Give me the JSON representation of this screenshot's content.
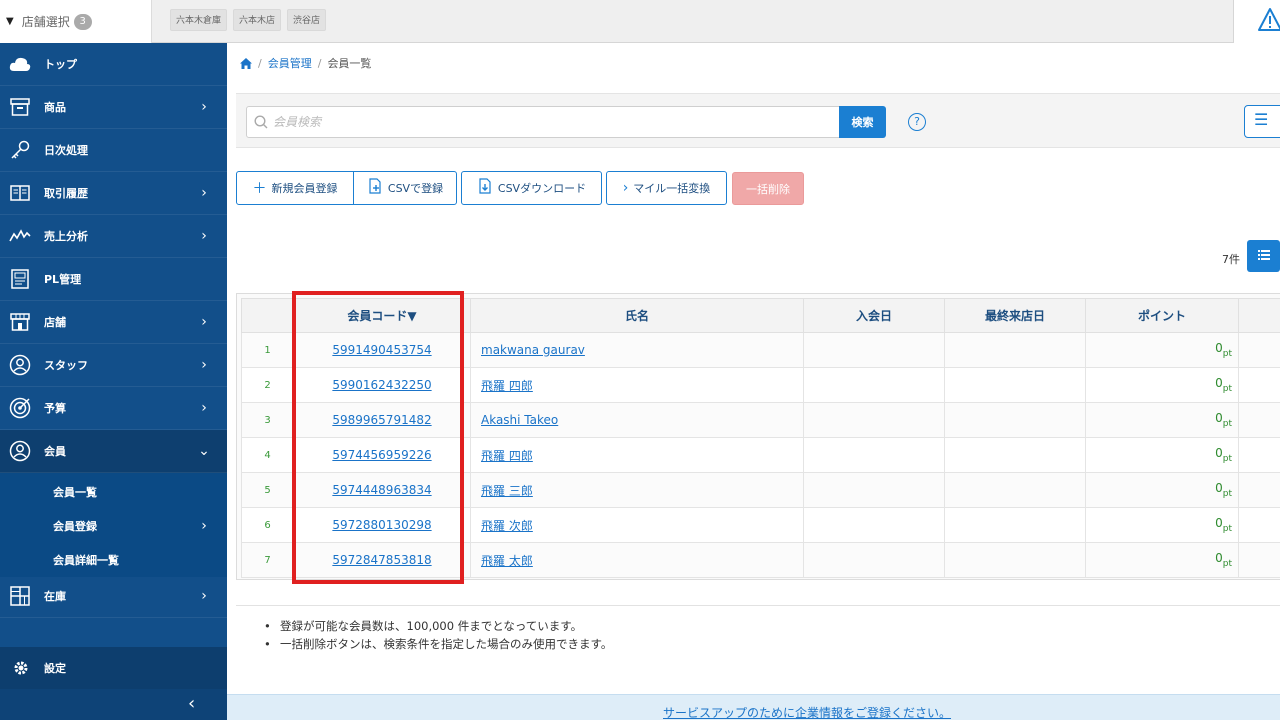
{
  "topbar": {
    "store_select_label": "店舗選択",
    "store_count": "3",
    "stores": [
      "六本木倉庫",
      "六本木店",
      "渋谷店"
    ]
  },
  "sidebar": {
    "items": [
      {
        "label": "トップ",
        "icon": "cloud-icon",
        "chevron": false
      },
      {
        "label": "商品",
        "icon": "box-icon",
        "chevron": true
      },
      {
        "label": "日次処理",
        "icon": "key-icon",
        "chevron": false
      },
      {
        "label": "取引履歴",
        "icon": "book-icon",
        "chevron": true
      },
      {
        "label": "売上分析",
        "icon": "line-chart-icon",
        "chevron": true
      },
      {
        "label": "PL管理",
        "icon": "report-icon",
        "chevron": false
      },
      {
        "label": "店舗",
        "icon": "store-icon",
        "chevron": true
      },
      {
        "label": "スタッフ",
        "icon": "person-icon",
        "chevron": true
      },
      {
        "label": "予算",
        "icon": "target-icon",
        "chevron": true
      },
      {
        "label": "会員",
        "icon": "member-icon",
        "chevron": true
      }
    ],
    "sub_items": [
      {
        "label": "会員一覧",
        "chevron": false
      },
      {
        "label": "会員登録",
        "chevron": true
      },
      {
        "label": "会員詳細一覧",
        "chevron": false
      }
    ],
    "inventory": {
      "label": "在庫",
      "icon": "grid-icon"
    },
    "settings_label": "設定",
    "collapse_glyph": "‹"
  },
  "breadcrumb": {
    "level1": "会員管理",
    "level2": "会員一覧"
  },
  "search": {
    "placeholder": "会員検索",
    "button": "検索",
    "help": "?"
  },
  "actions": {
    "new_member": "新規会員登録",
    "csv_register": "CSVで登録",
    "csv_download": "CSVダウンロード",
    "mile_convert": "マイル一括変換",
    "bulk_delete": "一括削除"
  },
  "count_label": "7件",
  "table": {
    "headers": {
      "code": "会員コード▼",
      "name": "氏名",
      "join_date": "入会日",
      "last_visit": "最終来店日",
      "points": "ポイント"
    },
    "point_unit": "pt",
    "rows": [
      {
        "no": "1",
        "code": "5991490453754",
        "name": "makwana gaurav",
        "join": "",
        "last": "",
        "points": "0"
      },
      {
        "no": "2",
        "code": "5990162432250",
        "name": "飛羅 四郎",
        "join": "",
        "last": "",
        "points": "0"
      },
      {
        "no": "3",
        "code": "5989965791482",
        "name": "Akashi Takeo",
        "join": "",
        "last": "",
        "points": "0"
      },
      {
        "no": "4",
        "code": "5974456959226",
        "name": "飛羅 四郎",
        "join": "",
        "last": "",
        "points": "0"
      },
      {
        "no": "5",
        "code": "5974448963834",
        "name": "飛羅 三郎",
        "join": "",
        "last": "",
        "points": "0"
      },
      {
        "no": "6",
        "code": "5972880130298",
        "name": "飛羅 次郎",
        "join": "",
        "last": "",
        "points": "0"
      },
      {
        "no": "7",
        "code": "5972847853818",
        "name": "飛羅 太郎",
        "join": "",
        "last": "",
        "points": "0"
      }
    ]
  },
  "notes": [
    "登録が可能な会員数は、100,000 件までとなっています。",
    "一括削除ボタンは、検索条件を指定した場合のみ使用できます。"
  ],
  "footer_link": "サービスアップのために企業情報をご登録ください。",
  "colors": {
    "sidebar": "#124f8a",
    "accent": "#1b7fd2",
    "highlight": "#e02020",
    "delete": "#f0a8a8"
  }
}
